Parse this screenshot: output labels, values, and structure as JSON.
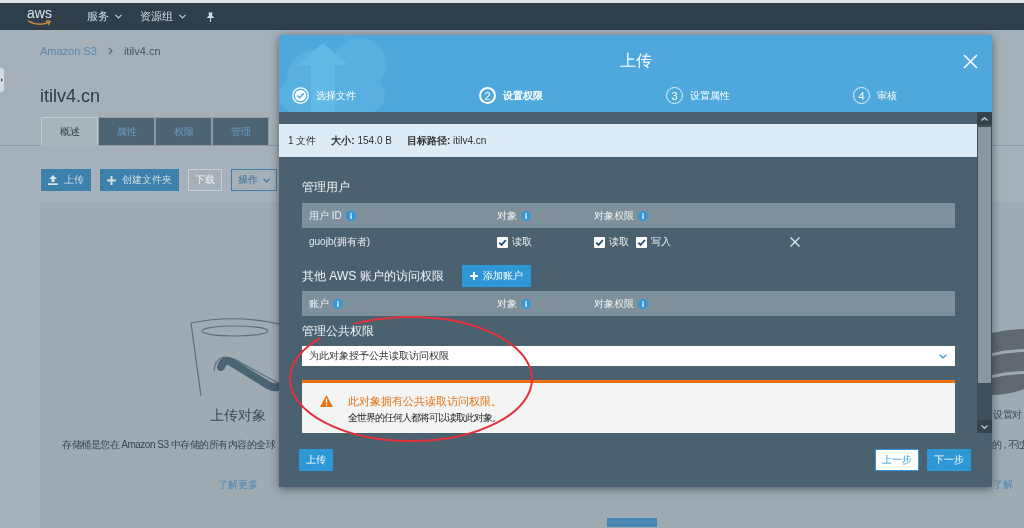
{
  "topbar": {
    "logo": "aws",
    "menus": [
      "服务",
      "资源组"
    ]
  },
  "breadcrumb": [
    "Amazon S3",
    "itilv4.cn"
  ],
  "title": "itilv4.cn",
  "tabs": [
    {
      "label": "概述",
      "selected": true
    },
    {
      "label": "属性",
      "selected": false
    },
    {
      "label": "权限",
      "selected": false
    },
    {
      "label": "管理",
      "selected": false
    }
  ],
  "actions": [
    {
      "kind": "upload",
      "label": "上传",
      "disabled": false
    },
    {
      "kind": "create",
      "label": "创建文件夹",
      "disabled": false
    },
    {
      "kind": "plain",
      "label": "下载",
      "disabled": true
    },
    {
      "kind": "menu",
      "label": "操作",
      "disabled": false
    }
  ],
  "panel": {
    "columns": [
      {
        "kind": "bucket",
        "title": "上传对象",
        "text": "存储桶是您在 Amazon S3 中存储的所有内容的全球",
        "link": "了解更多"
      },
      {
        "kind": "start"
      },
      {
        "kind": "disk",
        "title": "设置对",
        "text": "的，不过",
        "link": "了解"
      }
    ]
  },
  "modal": {
    "title": "上传",
    "steps": [
      {
        "completed": true,
        "selected": false,
        "label": "选择文件"
      },
      {
        "completed": false,
        "selected": true,
        "number": "2",
        "label": "设置权限"
      },
      {
        "completed": false,
        "selected": false,
        "number": "3",
        "label": "设置属性"
      },
      {
        "completed": false,
        "selected": false,
        "number": "4",
        "label": "审核"
      }
    ],
    "summary": [
      "1 文件",
      "**大小:** 154.0 B",
      "**目标路径:** itilv4.cn"
    ],
    "owners": {
      "title": "管理用户",
      "columns": [
        "用户 ID",
        "对象",
        "对象权限"
      ],
      "rows": [
        {
          "user": "guojb(拥有者)",
          "object": [
            {
              "label": "读取",
              "checked": true
            }
          ],
          "permissions": [
            {
              "label": "读取",
              "checked": true
            },
            {
              "label": "写入",
              "checked": true
            }
          ]
        }
      ]
    },
    "accounts": {
      "title": "其他 AWS 账户的访问权限",
      "add_button": "添加账户",
      "columns": [
        "账户",
        "对象",
        "对象权限"
      ]
    },
    "public": {
      "title": "管理公共权限",
      "select": {
        "value": "为此对象授予公共读取访问权限"
      },
      "warning": {
        "title": "此对象拥有公共读取访问权限。",
        "text": "全世界的任何人都将可以读取此对象。"
      }
    },
    "footer": {
      "left": "上传",
      "back": "上一步",
      "next": "下一步"
    }
  }
}
